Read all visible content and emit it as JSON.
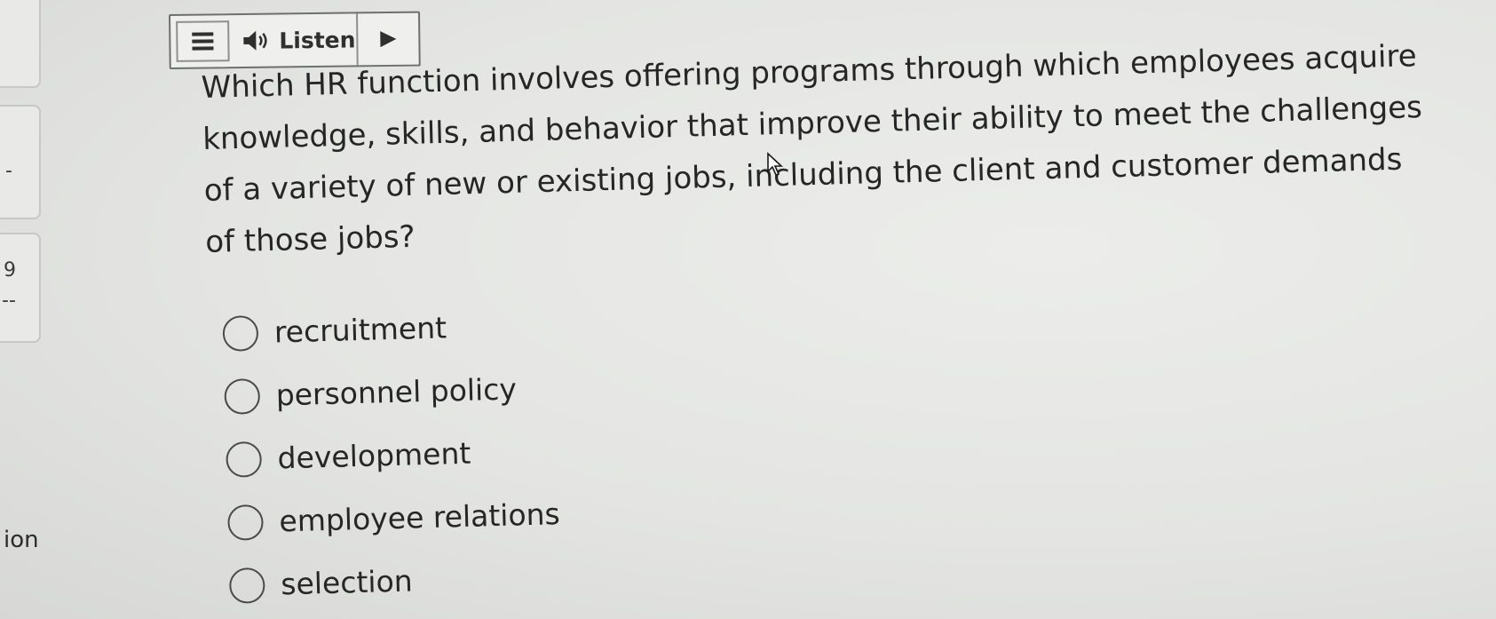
{
  "toolbar": {
    "menu_icon": "hamburger-menu-icon",
    "speaker_icon": "speaker-icon",
    "listen_label": "Listen",
    "play_icon": "play-icon"
  },
  "question": {
    "text": "Which HR function involves offering programs through which employees acquire knowledge, skills, and behavior that improve their ability to meet the challenges of a variety of new or existing jobs, including the client and customer demands of those jobs?"
  },
  "options": [
    {
      "label": "recruitment",
      "selected": false
    },
    {
      "label": "personnel policy",
      "selected": false
    },
    {
      "label": "development",
      "selected": false
    },
    {
      "label": "employee relations",
      "selected": false
    },
    {
      "label": "selection",
      "selected": false
    }
  ],
  "sidebar": {
    "fragment_2": "-",
    "fragment_3a": "9",
    "fragment_3b": "--",
    "fragment_text": "ion"
  }
}
